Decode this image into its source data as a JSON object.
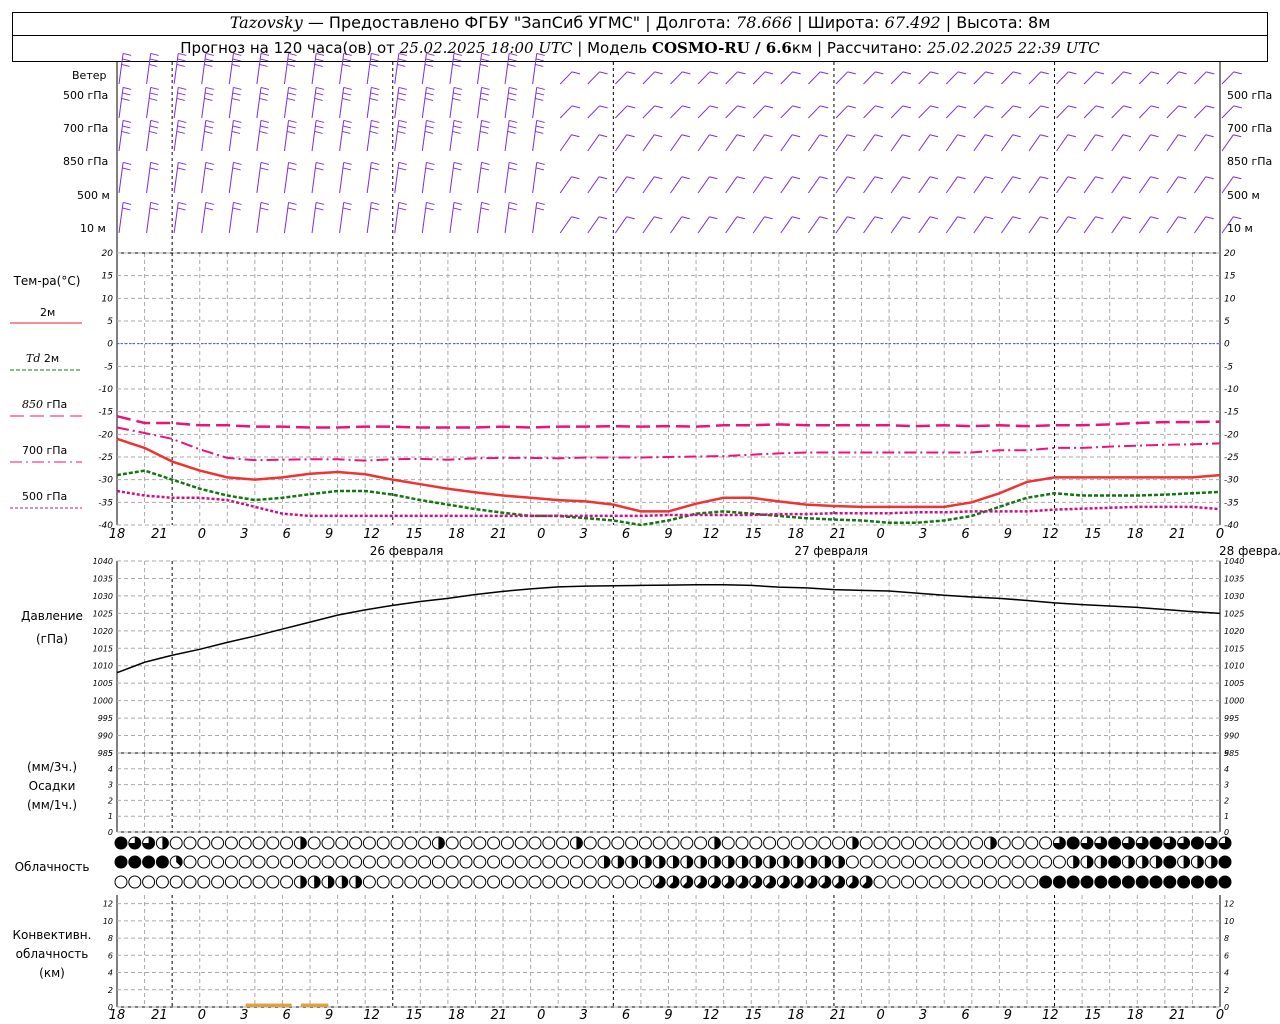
{
  "header": {
    "station": "Tazovsky",
    "provided": "— Предоставлено ФГБУ \"ЗапСиб УГМС\"",
    "lon_label": "Долгота:",
    "lon": "78.666",
    "lat_label": "Широта:",
    "lat": "67.492",
    "alt_label": "Высота:",
    "alt": "8м",
    "forecast_label": "Прогноз на 120 часа(ов) от",
    "forecast_start": "25.02.2025 18:00 UTC",
    "model_label": "Модель",
    "model": "COSMO-RU / 6.6",
    "model_unit": "км",
    "calc_label": "Рассчитано:",
    "calc_time": "25.02.2025 22:39 UTC"
  },
  "panels": {
    "wind": {
      "title": "Ветер",
      "levels": [
        "500 гПа",
        "700 гПа",
        "850 гПа",
        "500 м",
        "10 м"
      ]
    },
    "temp": {
      "title": "Тем-ра(°C)",
      "legend": [
        {
          "name": "2м",
          "prefix": "",
          "color": "#ee2222",
          "style": "solid"
        },
        {
          "name": "2м",
          "prefix": "Td",
          "color": "#117711",
          "style": "dash"
        },
        {
          "name": "гПа",
          "prefix": "850",
          "color": "#ee1177",
          "style": "longdash"
        },
        {
          "name": "гПа",
          "prefix": "700",
          "color": "#ee1177",
          "style": "dashdot"
        },
        {
          "name": "гПа",
          "prefix": "500",
          "color": "#cc1188",
          "style": "dot"
        }
      ]
    },
    "pressure": {
      "title": "Давление",
      "unit": "(гПа)"
    },
    "precip": {
      "unit1": "(мм/3ч.)",
      "title": "Осадки",
      "unit2": "(мм/1ч.)"
    },
    "cloud": {
      "title": "Облачность"
    },
    "conv": {
      "title1": "Конвективн.",
      "title2": "облачность",
      "unit": "(км)"
    }
  },
  "time_axis": {
    "labels": [
      "18",
      "21",
      "0",
      "3",
      "6",
      "9",
      "12",
      "15",
      "18",
      "21",
      "0",
      "3",
      "6",
      "9",
      "12",
      "15",
      "18",
      "21",
      "0",
      "3",
      "6",
      "9",
      "12",
      "15",
      "18",
      "21",
      "0"
    ],
    "dates": [
      "26 февраля",
      "27 февраля",
      "28 февраля"
    ]
  },
  "chart_data": [
    {
      "type": "line",
      "title": "Тем-ра(°C)",
      "x_hours": [
        0,
        3,
        6,
        9,
        12,
        15,
        18,
        21,
        24,
        27,
        30,
        33,
        36,
        39,
        42,
        45,
        48,
        51,
        54,
        57,
        60,
        63,
        66,
        69,
        72,
        75,
        78,
        81,
        84,
        87,
        90,
        93,
        96,
        99,
        102,
        105,
        108,
        111,
        114,
        117,
        120
      ],
      "ylim": [
        -40,
        20
      ],
      "yticks": [
        20,
        15,
        10,
        5,
        0,
        -5,
        -10,
        -15,
        -20,
        -25,
        -30,
        -35,
        -40
      ],
      "zero_line": true,
      "series": [
        {
          "name": "2м",
          "color": "#ee3333",
          "values": [
            -21,
            -23,
            -26,
            -28,
            -29.5,
            -30,
            -29.5,
            -28.7,
            -28.3,
            -28.8,
            -30,
            -31,
            -32,
            -32.8,
            -33.5,
            -34,
            -34.5,
            -34.8,
            -35.5,
            -37,
            -37,
            -35.3,
            -34,
            -34,
            -34.8,
            -35.5,
            -35.8,
            -36,
            -36,
            -36,
            -36,
            -35,
            -33,
            -30.5,
            -29.5,
            -29.5,
            -29.5,
            -29.5,
            -29.5,
            -29.5,
            -29
          ]
        },
        {
          "name": "Td 2м",
          "color": "#117711",
          "values": [
            -29,
            -28,
            -30,
            -32,
            -33.5,
            -34.5,
            -34,
            -33.2,
            -32.5,
            -32.5,
            -33.3,
            -34.5,
            -35.5,
            -36.5,
            -37.3,
            -38,
            -38,
            -38.5,
            -39,
            -40,
            -39,
            -37.5,
            -37,
            -37.5,
            -38,
            -38.5,
            -38.8,
            -39,
            -39.5,
            -39.5,
            -39,
            -38,
            -36,
            -34,
            -33,
            -33.5,
            -33.5,
            -33.5,
            -33.3,
            -33,
            -32.7
          ]
        },
        {
          "name": "850 гПа",
          "color": "#ee1177",
          "values": [
            -16,
            -17.5,
            -17.5,
            -18,
            -18,
            -18.3,
            -18.3,
            -18.5,
            -18.5,
            -18.3,
            -18.3,
            -18.5,
            -18.5,
            -18.5,
            -18.3,
            -18.5,
            -18.3,
            -18.3,
            -18.2,
            -18.3,
            -18.2,
            -18.3,
            -18,
            -18,
            -17.8,
            -18,
            -18,
            -18,
            -18,
            -18.2,
            -18,
            -18.2,
            -18,
            -18.2,
            -18,
            -18,
            -17.8,
            -17.5,
            -17.3,
            -17.3,
            -17.2
          ]
        },
        {
          "name": "700 гПа",
          "color": "#ee1177",
          "values": [
            -18.5,
            -19.7,
            -21,
            -23.3,
            -25.2,
            -25.7,
            -25.6,
            -25.5,
            -25.5,
            -25.8,
            -25.5,
            -25.4,
            -25.6,
            -25.3,
            -25.2,
            -25.2,
            -25.3,
            -25.1,
            -25.1,
            -25.1,
            -25,
            -24.9,
            -24.8,
            -24.5,
            -24.2,
            -24,
            -24,
            -24,
            -24,
            -24,
            -24,
            -24,
            -23.5,
            -23.5,
            -23,
            -23,
            -22.7,
            -22.5,
            -22.3,
            -22.2,
            -22
          ]
        },
        {
          "name": "500 гПа",
          "color": "#cc1188",
          "values": [
            -32.5,
            -33.5,
            -34,
            -34,
            -34.5,
            -36,
            -37.5,
            -38,
            -38,
            -38,
            -38,
            -38,
            -38,
            -38,
            -38,
            -38,
            -38,
            -38,
            -38,
            -38,
            -37.8,
            -37.8,
            -37.8,
            -37.8,
            -37.6,
            -37.6,
            -37.4,
            -37.4,
            -37.4,
            -37.2,
            -37.2,
            -37,
            -37,
            -37,
            -36.6,
            -36.4,
            -36.2,
            -36,
            -36,
            -36,
            -36.5
          ]
        }
      ]
    },
    {
      "type": "line",
      "title": "Давление",
      "x_hours": [
        0,
        3,
        6,
        9,
        12,
        15,
        18,
        21,
        24,
        27,
        30,
        33,
        36,
        39,
        42,
        45,
        48,
        51,
        54,
        57,
        60,
        63,
        66,
        69,
        72,
        75,
        78,
        81,
        84,
        87,
        90,
        93,
        96,
        99,
        102,
        105,
        108,
        111,
        114,
        117,
        120
      ],
      "ylim": [
        985,
        1040
      ],
      "yticks": [
        1040,
        1035,
        1030,
        1025,
        1020,
        1015,
        1010,
        1005,
        1000,
        995,
        990,
        985
      ],
      "series": [
        {
          "name": "Давление",
          "color": "#000000",
          "values": [
            1008,
            1011,
            1013,
            1014.7,
            1016.7,
            1018.5,
            1020.5,
            1022.5,
            1024.5,
            1026,
            1027.3,
            1028.4,
            1029.3,
            1030.4,
            1031.3,
            1032,
            1032.6,
            1032.8,
            1032.9,
            1033,
            1033.1,
            1033.2,
            1033.2,
            1033,
            1032.5,
            1032.3,
            1031.8,
            1031.6,
            1031.4,
            1030.8,
            1030.2,
            1029.7,
            1029.3,
            1028.7,
            1028,
            1027.5,
            1027.1,
            1026.7,
            1026.1,
            1025.5,
            1025
          ]
        }
      ]
    },
    {
      "type": "bar",
      "title": "Осадки",
      "ylim": [
        0,
        5
      ],
      "yticks": [
        5,
        4,
        3,
        2,
        1,
        0
      ],
      "values": []
    },
    {
      "type": "table",
      "title": "Облачность",
      "levels": [
        "upper",
        "middle",
        "lower"
      ],
      "cover_oktas_every_hour": {
        "upper": [
          8,
          6,
          6,
          4,
          0,
          0,
          0,
          0,
          0,
          0,
          0,
          0,
          0,
          0,
          0,
          0,
          0,
          0,
          0,
          0,
          0,
          0,
          0,
          0,
          0,
          0,
          0,
          0,
          0,
          0,
          0,
          0,
          0,
          0,
          0,
          0,
          0,
          0,
          0,
          0,
          0,
          0,
          0,
          0,
          0,
          0,
          0,
          0,
          0,
          0,
          0,
          0,
          0,
          0,
          0,
          0,
          0,
          0,
          0,
          0,
          0,
          0,
          0,
          0,
          0,
          0,
          0,
          0,
          0,
          0,
          0,
          0,
          0,
          0,
          0,
          0,
          0,
          0,
          0,
          0,
          0,
          0,
          0,
          0,
          0,
          0,
          0,
          0,
          0,
          0,
          0,
          0,
          0,
          0,
          0,
          0,
          0,
          0,
          0,
          0,
          0,
          0,
          0,
          0,
          0,
          0,
          0,
          0,
          0,
          0,
          0,
          0,
          0,
          0,
          0,
          0,
          0,
          0,
          0,
          0,
          0
        ],
        "middle": [
          8,
          8,
          8,
          8,
          3,
          0,
          0,
          0,
          0,
          0,
          0,
          0,
          0,
          0,
          0,
          0,
          0,
          0,
          0,
          0,
          0,
          0,
          0,
          0,
          0,
          0,
          0,
          0,
          0,
          0,
          0,
          0,
          0,
          0,
          0,
          0,
          0,
          0,
          0,
          0,
          0,
          0,
          0,
          0,
          0,
          0,
          0,
          0,
          0,
          0,
          0,
          0,
          0,
          0,
          0,
          0,
          0,
          0,
          0,
          0,
          0,
          0,
          0,
          0,
          0,
          0,
          0,
          0,
          0,
          0,
          0,
          0,
          0,
          0,
          0,
          0,
          0,
          0,
          0,
          0,
          0,
          0,
          0,
          0,
          0,
          0,
          0,
          0,
          0,
          0,
          0,
          0,
          0,
          0,
          0,
          0,
          0,
          0,
          0,
          0,
          0,
          0,
          0,
          0,
          0,
          0,
          0,
          0,
          0,
          0,
          0,
          0,
          0,
          0,
          0,
          0,
          0,
          0,
          0,
          0,
          0
        ],
        "lower": [
          0,
          0,
          0,
          0,
          0,
          0,
          0,
          0,
          0,
          0,
          0,
          0,
          0,
          0,
          0,
          0,
          0,
          0,
          0,
          0,
          0,
          0,
          0,
          0,
          0,
          0,
          0,
          0,
          0,
          0,
          0,
          0,
          0,
          0,
          0,
          0,
          0,
          0,
          0,
          0,
          0,
          0,
          0,
          0,
          0,
          0,
          0,
          0,
          0,
          0,
          0,
          0,
          0,
          0,
          0,
          0,
          0,
          0,
          0,
          0,
          0,
          0,
          0,
          0,
          0,
          0,
          0,
          0,
          0,
          0,
          0,
          0,
          0,
          0,
          0,
          0,
          0,
          0,
          0,
          0,
          0,
          0,
          0,
          0,
          0,
          0,
          0,
          0,
          0,
          0,
          0,
          0,
          0,
          0,
          0,
          0,
          0,
          0,
          0,
          0,
          0,
          0,
          0,
          0,
          0,
          0,
          0,
          0,
          0,
          0,
          0,
          0,
          0,
          0,
          0,
          0,
          0,
          0,
          0,
          0,
          0
        ]
      },
      "upper_overrides": [
        [
          30,
          4
        ],
        [
          33,
          4
        ],
        [
          34,
          4
        ],
        [
          35,
          4
        ],
        [
          36,
          4
        ],
        [
          37,
          4
        ],
        [
          38,
          4
        ],
        [
          39,
          4
        ],
        [
          40,
          4
        ],
        [
          42,
          4
        ],
        [
          44,
          4
        ],
        [
          45,
          4
        ],
        [
          46,
          4
        ],
        [
          48,
          4
        ],
        [
          49,
          4
        ],
        [
          50,
          4
        ],
        [
          51,
          4
        ],
        [
          52,
          4
        ],
        [
          53,
          4
        ],
        [
          54,
          4
        ],
        [
          55,
          4
        ],
        [
          56,
          4
        ],
        [
          57,
          4
        ],
        [
          58,
          4
        ],
        [
          59,
          4
        ],
        [
          60,
          4
        ],
        [
          61,
          4
        ],
        [
          62,
          4
        ],
        [
          63,
          4
        ],
        [
          64,
          4
        ],
        [
          65,
          4
        ],
        [
          66,
          4
        ],
        [
          67,
          4
        ],
        [
          68,
          4
        ],
        [
          69,
          4
        ],
        [
          70,
          4
        ],
        [
          71,
          4
        ],
        [
          72,
          4
        ],
        [
          73,
          4
        ],
        [
          74,
          4
        ],
        [
          75,
          4
        ],
        [
          76,
          4
        ],
        [
          77,
          4
        ],
        [
          78,
          4
        ],
        [
          79,
          4
        ],
        [
          80,
          4
        ],
        [
          81,
          4
        ],
        [
          82,
          4
        ],
        [
          83,
          4
        ],
        [
          84,
          4
        ],
        [
          85,
          4
        ],
        [
          86,
          4
        ],
        [
          87,
          4
        ],
        [
          88,
          4
        ],
        [
          89,
          4
        ],
        [
          90,
          4
        ],
        [
          91,
          4
        ],
        [
          92,
          4
        ],
        [
          93,
          4
        ],
        [
          94,
          4
        ],
        [
          95,
          4
        ],
        [
          96,
          4
        ],
        [
          97,
          4
        ],
        [
          98,
          4
        ],
        [
          99,
          4
        ],
        [
          100,
          4
        ],
        [
          101,
          4
        ],
        [
          102,
          4
        ],
        [
          103,
          4
        ],
        [
          104,
          4
        ],
        [
          105,
          4
        ],
        [
          106,
          4
        ],
        [
          107,
          4
        ],
        [
          108,
          4
        ],
        [
          109,
          4
        ],
        [
          110,
          4
        ],
        [
          111,
          4
        ],
        [
          112,
          4
        ],
        [
          113,
          4
        ],
        [
          114,
          4
        ],
        [
          115,
          4
        ],
        [
          116,
          4
        ],
        [
          117,
          4
        ],
        [
          118,
          4
        ],
        [
          119,
          4
        ],
        [
          120,
          4
        ]
      ]
    },
    {
      "type": "bar",
      "title": "Конвективн. облачность",
      "ylim": [
        0,
        13
      ],
      "yticks": [
        12,
        10,
        8,
        6,
        4,
        2,
        0
      ],
      "bars": [
        {
          "from_hour": 14,
          "to_hour": 19,
          "base_km": 0,
          "top_km": 0.4
        },
        {
          "from_hour": 20,
          "to_hour": 23,
          "base_km": 0,
          "top_km": 0.4
        }
      ]
    }
  ]
}
